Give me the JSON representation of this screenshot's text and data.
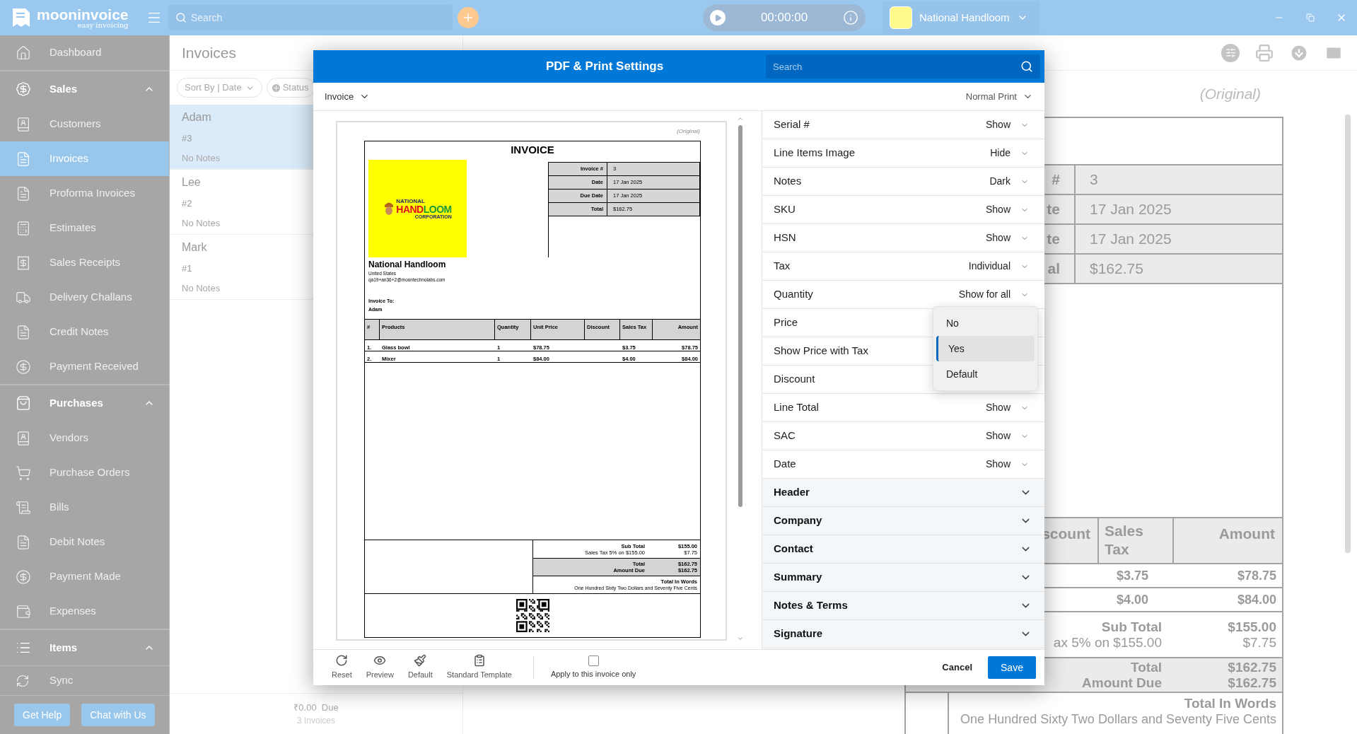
{
  "app": {
    "brand": "mooninvoice",
    "tagline": "easy invoicing",
    "search_placeholder": "Search",
    "timer": "00:00:00",
    "company": "National Handloom"
  },
  "sidebar": {
    "items": [
      {
        "kind": "link",
        "label": "Dashboard",
        "selected": false
      },
      {
        "kind": "section",
        "label": "Sales",
        "expanded": true
      },
      {
        "kind": "link",
        "label": "Customers",
        "selected": false
      },
      {
        "kind": "link",
        "label": "Invoices",
        "selected": true
      },
      {
        "kind": "link",
        "label": "Proforma Invoices",
        "selected": false
      },
      {
        "kind": "link",
        "label": "Estimates",
        "selected": false
      },
      {
        "kind": "link",
        "label": "Sales Receipts",
        "selected": false
      },
      {
        "kind": "link",
        "label": "Delivery Challans",
        "selected": false
      },
      {
        "kind": "link",
        "label": "Credit Notes",
        "selected": false
      },
      {
        "kind": "link",
        "label": "Payment Received",
        "selected": false
      },
      {
        "kind": "section",
        "label": "Purchases",
        "expanded": true
      },
      {
        "kind": "link",
        "label": "Vendors",
        "selected": false
      },
      {
        "kind": "link",
        "label": "Purchase Orders",
        "selected": false
      },
      {
        "kind": "link",
        "label": "Bills",
        "selected": false
      },
      {
        "kind": "link",
        "label": "Debit Notes",
        "selected": false
      },
      {
        "kind": "link",
        "label": "Payment Made",
        "selected": false
      },
      {
        "kind": "link",
        "label": "Expenses",
        "selected": false
      },
      {
        "kind": "section",
        "label": "Items",
        "expanded": true
      }
    ],
    "sync": "Sync",
    "buttons": [
      "Get Help",
      "Chat with Us"
    ]
  },
  "invoice_list": {
    "title": "Invoices",
    "sort": "Sort By | Date",
    "filter": "Status",
    "items": [
      {
        "name": "Adam",
        "number": "#3",
        "notes": "No Notes",
        "selected": true
      },
      {
        "name": "Lee",
        "number": "#2",
        "notes": "No Notes",
        "selected": false
      },
      {
        "name": "Mark",
        "number": "#1",
        "notes": "No Notes",
        "selected": false
      }
    ],
    "footer": {
      "amount": "₹0.00",
      "due": "Due",
      "count": "3 Invoices"
    }
  },
  "background_invoice": {
    "copy_label": "(Original)",
    "info": [
      {
        "label": "#",
        "value": "3"
      },
      {
        "label": "te",
        "value": "17 Jan 2025"
      },
      {
        "label": "te",
        "value": "17 Jan 2025"
      },
      {
        "label": "al",
        "value": "$162.75"
      }
    ],
    "columns": [
      "scount",
      "Sales Tax",
      "Amount"
    ],
    "rows": [
      {
        "sales_tax": "$3.75",
        "amount": "$78.75"
      },
      {
        "sales_tax": "$4.00",
        "amount": "$84.00"
      }
    ],
    "summary": {
      "subtotal_label": "Sub Total",
      "subtotal": "$155.00",
      "tax_label": "ax 5% on $155.00",
      "tax": "$7.75",
      "total_label": "Total",
      "total": "$162.75",
      "due_label": "Amount Due",
      "due": "$162.75",
      "words_label": "Total In Words",
      "words": "One Hundred Sixty Two Dollars and Seventy Five Cents"
    }
  },
  "dialog": {
    "title": "PDF & Print Settings",
    "search_placeholder": "Search",
    "document_type": "Invoice",
    "print_mode": "Normal Print",
    "preview": {
      "copy_label": "(Original)",
      "title": "INVOICE",
      "logo": {
        "line1": "NATIONAL",
        "line2a": "HAND",
        "line2b": "LOOM",
        "line3": "CORPORATION"
      },
      "info": [
        {
          "label": "Invoice #",
          "value": "3"
        },
        {
          "label": "Date",
          "value": "17 Jan 2025"
        },
        {
          "label": "Due Date",
          "value": "17 Jan 2025"
        },
        {
          "label": "Total",
          "value": "$162.75"
        }
      ],
      "company": {
        "name": "National Handloom",
        "country": "United States",
        "email": "qa19+an36+2@moontechnolabs.com"
      },
      "bill_to_label": "Invoice To:",
      "bill_to": "Adam",
      "columns": [
        "#",
        "Products",
        "Quantity",
        "Unit Price",
        "Discount",
        "Sales Tax",
        "Amount"
      ],
      "rows": [
        {
          "num": "1.",
          "product": "Glass bowl",
          "quantity": "1",
          "unit_price": "$78.75",
          "sales_tax": "$3.75",
          "amount": "$78.75"
        },
        {
          "num": "2.",
          "product": "Mixer",
          "quantity": "1",
          "unit_price": "$84.00",
          "sales_tax": "$4.00",
          "amount": "$84.00"
        }
      ],
      "summary": {
        "subtotal_label": "Sub Total",
        "subtotal": "$155.00",
        "tax_label": "Sales Tax 5% on $155.00",
        "tax": "$7.75",
        "total_label": "Total",
        "total": "$162.75",
        "due_label": "Amount Due",
        "due": "$162.75",
        "words_label": "Total In Words",
        "words": "One Hundred Sixty Two Dollars and Seventy Five Cents"
      }
    },
    "settings": [
      {
        "kind": "option",
        "label": "Serial #",
        "value": "Show"
      },
      {
        "kind": "option",
        "label": "Line Items Image",
        "value": "Hide"
      },
      {
        "kind": "option",
        "label": "Notes",
        "value": "Dark"
      },
      {
        "kind": "option",
        "label": "SKU",
        "value": "Show"
      },
      {
        "kind": "option",
        "label": "HSN",
        "value": "Show"
      },
      {
        "kind": "option",
        "label": "Tax",
        "value": "Individual"
      },
      {
        "kind": "option",
        "label": "Quantity",
        "value": "Show for all"
      },
      {
        "kind": "option",
        "label": "Price"
      },
      {
        "kind": "option",
        "label": "Show Price with Tax"
      },
      {
        "kind": "option",
        "label": "Discount"
      },
      {
        "kind": "option",
        "label": "Line Total",
        "value": "Show"
      },
      {
        "kind": "option",
        "label": "SAC",
        "value": "Show"
      },
      {
        "kind": "option",
        "label": "Date",
        "value": "Show"
      },
      {
        "kind": "section",
        "label": "Header",
        "expanded": false
      },
      {
        "kind": "section",
        "label": "Company",
        "expanded": false
      },
      {
        "kind": "section",
        "label": "Contact",
        "expanded": false
      },
      {
        "kind": "section",
        "label": "Summary",
        "expanded": false
      },
      {
        "kind": "section",
        "label": "Notes & Terms",
        "expanded": false
      },
      {
        "kind": "section",
        "label": "Signature",
        "expanded": false
      }
    ],
    "dropdown": {
      "options": [
        {
          "label": "No",
          "selected": false
        },
        {
          "label": "Yes",
          "selected": true
        },
        {
          "label": "Default",
          "selected": false
        }
      ]
    },
    "tools": [
      {
        "label": "Reset"
      },
      {
        "label": "Preview"
      },
      {
        "label": "Default"
      },
      {
        "label": "Standard Template"
      }
    ],
    "apply_checkbox": {
      "label": "Apply to this invoice only",
      "checked": false
    },
    "cancel": "Cancel",
    "save": "Save"
  }
}
